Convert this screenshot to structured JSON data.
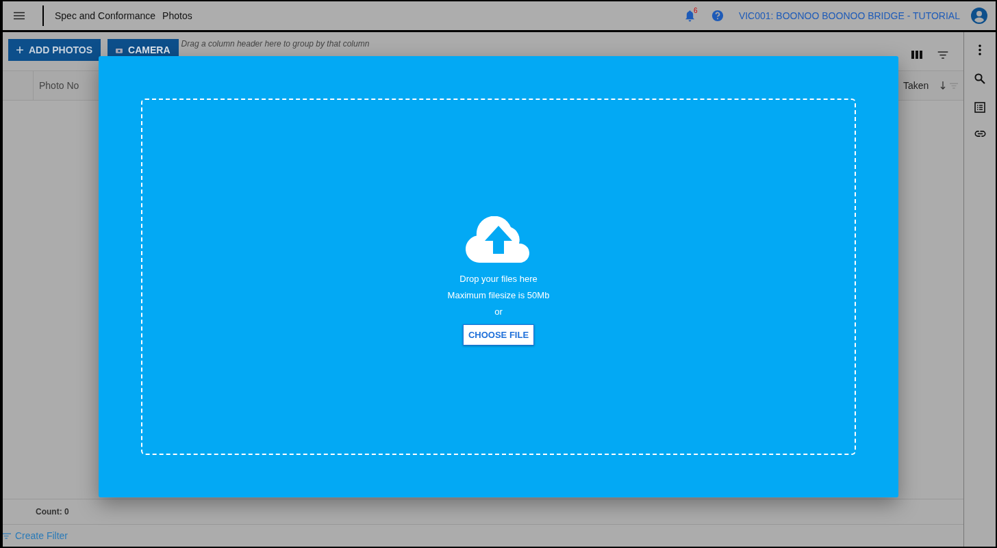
{
  "header": {
    "breadcrumb": [
      "Spec and Conformance",
      "Photos"
    ],
    "notifications": "6",
    "project": "VIC001: BOONOO BOONOO BRIDGE - TUTORIAL"
  },
  "toolbar": {
    "buttons": [
      "ADD PHOTOS",
      "CAMERA"
    ],
    "group_hint": "Drag a column header here to group by that column"
  },
  "table": {
    "columns": [
      {
        "label": "Photo No",
        "sorted": false
      },
      {
        "label": "Taken",
        "sorted": true
      }
    ]
  },
  "footer": {
    "count": "Count: 0",
    "filter_link": "Create Filter"
  },
  "upload_dialog": {
    "lines": [
      "Drop your files here",
      "Maximum filesize is 50Mb",
      "or"
    ],
    "button": "CHOOSE FILE"
  }
}
